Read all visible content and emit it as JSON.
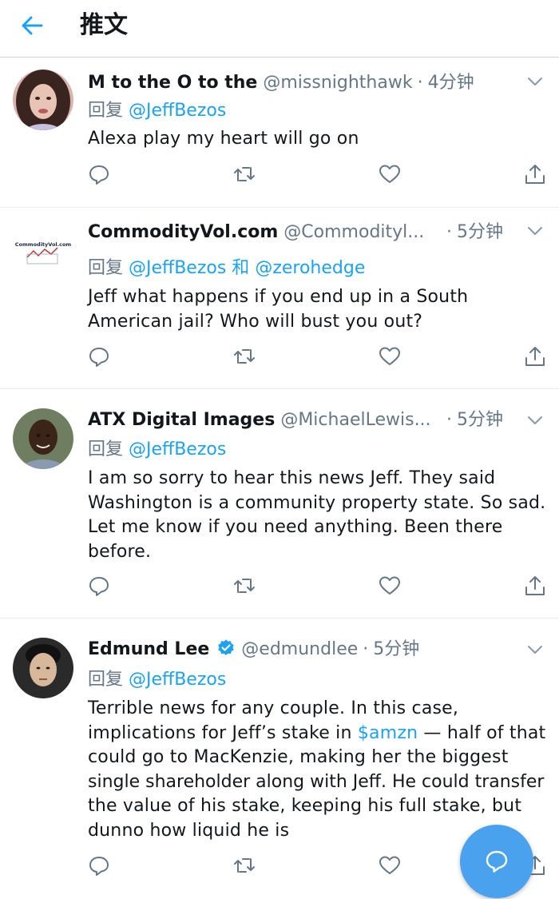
{
  "header": {
    "title": "推文"
  },
  "tweets": [
    {
      "name": "M to the O to the",
      "handle": "@missnighthawk",
      "time": "4分钟",
      "reply_prefix": "回复",
      "mention1": "@JeffBezos",
      "text_lines": [
        "Alexa play my heart will go on"
      ]
    },
    {
      "name": "CommodityVol.com",
      "handle": "@Commodityl...",
      "time": "5分钟",
      "reply_prefix": "回复",
      "mention1": "@JeffBezos",
      "conj": "和",
      "mention2": "@zerohedge",
      "avatar_text": "CommodityVol.com",
      "text_lines": [
        "Jeff what happens if you end up in a South",
        "American jail? Who will bust you out?"
      ]
    },
    {
      "name": "ATX Digital Images",
      "handle": "@MichaelLewis...",
      "time": "5分钟",
      "reply_prefix": "回复",
      "mention1": "@JeffBezos",
      "text_lines": [
        "I am so sorry to hear this news Jeff. They said",
        "Washington is a community property state. So sad.",
        "Let me know if you need anything. Been there",
        "before."
      ]
    },
    {
      "name": "Edmund Lee",
      "handle": "@edmundlee",
      "time": "5分钟",
      "reply_prefix": "回复",
      "mention1": "@JeffBezos",
      "text_line1": "Terrible news for any couple. In this case,",
      "text_line2_a": "implications for Jeff’s stake in ",
      "cashtag": "$amzn",
      "text_line2_b": " — half of that",
      "text_line3": "could go to MacKenzie, making her the biggest",
      "text_line4": "single shareholder along with Jeff. He could transfer",
      "text_line5": "the value of his stake, keeping his full stake, but",
      "text_line6": "dunno how liquid he is"
    }
  ],
  "colors": {
    "accent": "#1da1f2",
    "muted": "#657786",
    "fab": "#4aa1ee",
    "verified": "#1da1f2"
  },
  "icons": [
    "back-arrow-icon",
    "chevron-down-icon",
    "reply-icon",
    "retweet-icon",
    "like-icon",
    "share-icon",
    "verified-badge-icon",
    "compose-reply-icon"
  ]
}
